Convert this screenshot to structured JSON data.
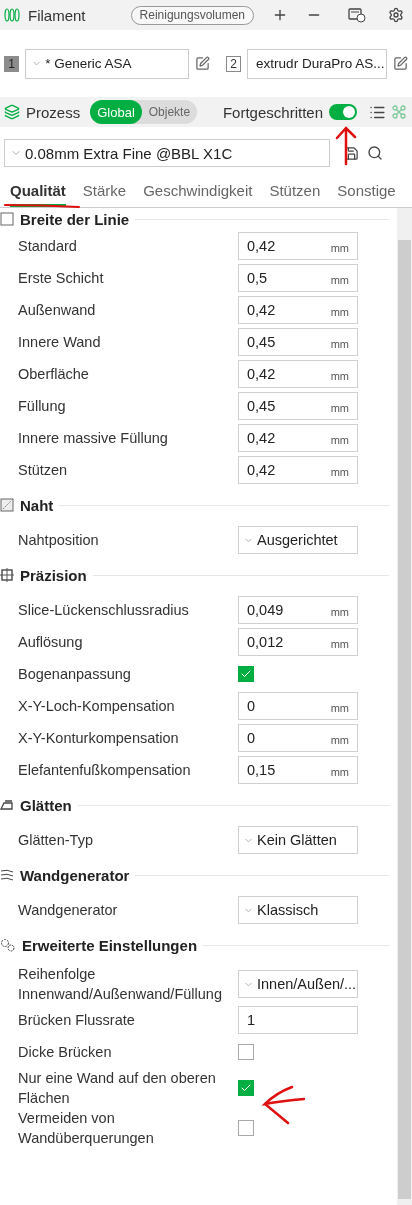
{
  "header": {
    "title": "Filament",
    "purge_button": "Reinigungsvolumen"
  },
  "extruders": [
    {
      "number": "1",
      "selected": true,
      "filament": "* Generic ASA"
    },
    {
      "number": "2",
      "selected": false,
      "filament": "extrudr DuraPro AS..."
    }
  ],
  "process": {
    "title": "Prozess",
    "modes": [
      {
        "label": "Global",
        "selected": true
      },
      {
        "label": "Objekte",
        "selected": false
      }
    ],
    "advanced_label": "Fortgeschritten",
    "advanced_on": true
  },
  "preset": "0.08mm Extra Fine @BBL X1C",
  "tabs": [
    {
      "label": "Qualität",
      "selected": true
    },
    {
      "label": "Stärke",
      "selected": false
    },
    {
      "label": "Geschwindigkeit",
      "selected": false
    },
    {
      "label": "Stützen",
      "selected": false
    },
    {
      "label": "Sonstige",
      "selected": false
    }
  ],
  "sections": [
    {
      "title": "Breite der Linie",
      "settings": [
        {
          "kind": "number",
          "label": "Standard",
          "value": "0,42",
          "unit": "mm"
        },
        {
          "kind": "number",
          "label": "Erste Schicht",
          "value": "0,5",
          "unit": "mm"
        },
        {
          "kind": "number",
          "label": "Außenwand",
          "value": "0,42",
          "unit": "mm"
        },
        {
          "kind": "number",
          "label": "Innere Wand",
          "value": "0,45",
          "unit": "mm"
        },
        {
          "kind": "number",
          "label": "Oberfläche",
          "value": "0,42",
          "unit": "mm"
        },
        {
          "kind": "number",
          "label": "Füllung",
          "value": "0,45",
          "unit": "mm"
        },
        {
          "kind": "number",
          "label": "Innere massive Füllung",
          "value": "0,42",
          "unit": "mm"
        },
        {
          "kind": "number",
          "label": "Stützen",
          "value": "0,42",
          "unit": "mm"
        }
      ]
    },
    {
      "title": "Naht",
      "settings": [
        {
          "kind": "dropdown",
          "label": "Nahtposition",
          "value": "Ausgerichtet"
        }
      ]
    },
    {
      "title": "Präzision",
      "settings": [
        {
          "kind": "number",
          "label": "Slice-Lückenschlussradius",
          "value": "0,049",
          "unit": "mm"
        },
        {
          "kind": "number",
          "label": "Auflösung",
          "value": "0,012",
          "unit": "mm"
        },
        {
          "kind": "checkbox",
          "label": "Bogenanpassung",
          "checked": true
        },
        {
          "kind": "number",
          "label": "X-Y-Loch-Kompensation",
          "value": "0",
          "unit": "mm"
        },
        {
          "kind": "number",
          "label": "X-Y-Konturkompensation",
          "value": "0",
          "unit": "mm"
        },
        {
          "kind": "number",
          "label": "Elefantenfußkompensation",
          "value": "0,15",
          "unit": "mm"
        }
      ]
    },
    {
      "title": "Glätten",
      "settings": [
        {
          "kind": "dropdown",
          "label": "Glätten-Typ",
          "value": "Kein Glätten"
        }
      ]
    },
    {
      "title": "Wandgenerator",
      "settings": [
        {
          "kind": "dropdown",
          "label": "Wandgenerator",
          "value": "Klassisch"
        }
      ]
    },
    {
      "title": "Erweiterte Einstellungen",
      "settings": [
        {
          "kind": "dropdown",
          "label": "Reihenfolge Innenwand/Außenwand/Füllung",
          "value": "Innen/Außen/..."
        },
        {
          "kind": "number",
          "label": "Brücken Flussrate",
          "value": "1"
        },
        {
          "kind": "checkbox",
          "label": "Dicke Brücken",
          "checked": false
        },
        {
          "kind": "checkbox",
          "label": "Nur eine Wand auf den oberen Flächen",
          "checked": true
        },
        {
          "kind": "checkbox",
          "label": "Vermeiden von Wandüberquerungen",
          "checked": false
        }
      ]
    }
  ]
}
